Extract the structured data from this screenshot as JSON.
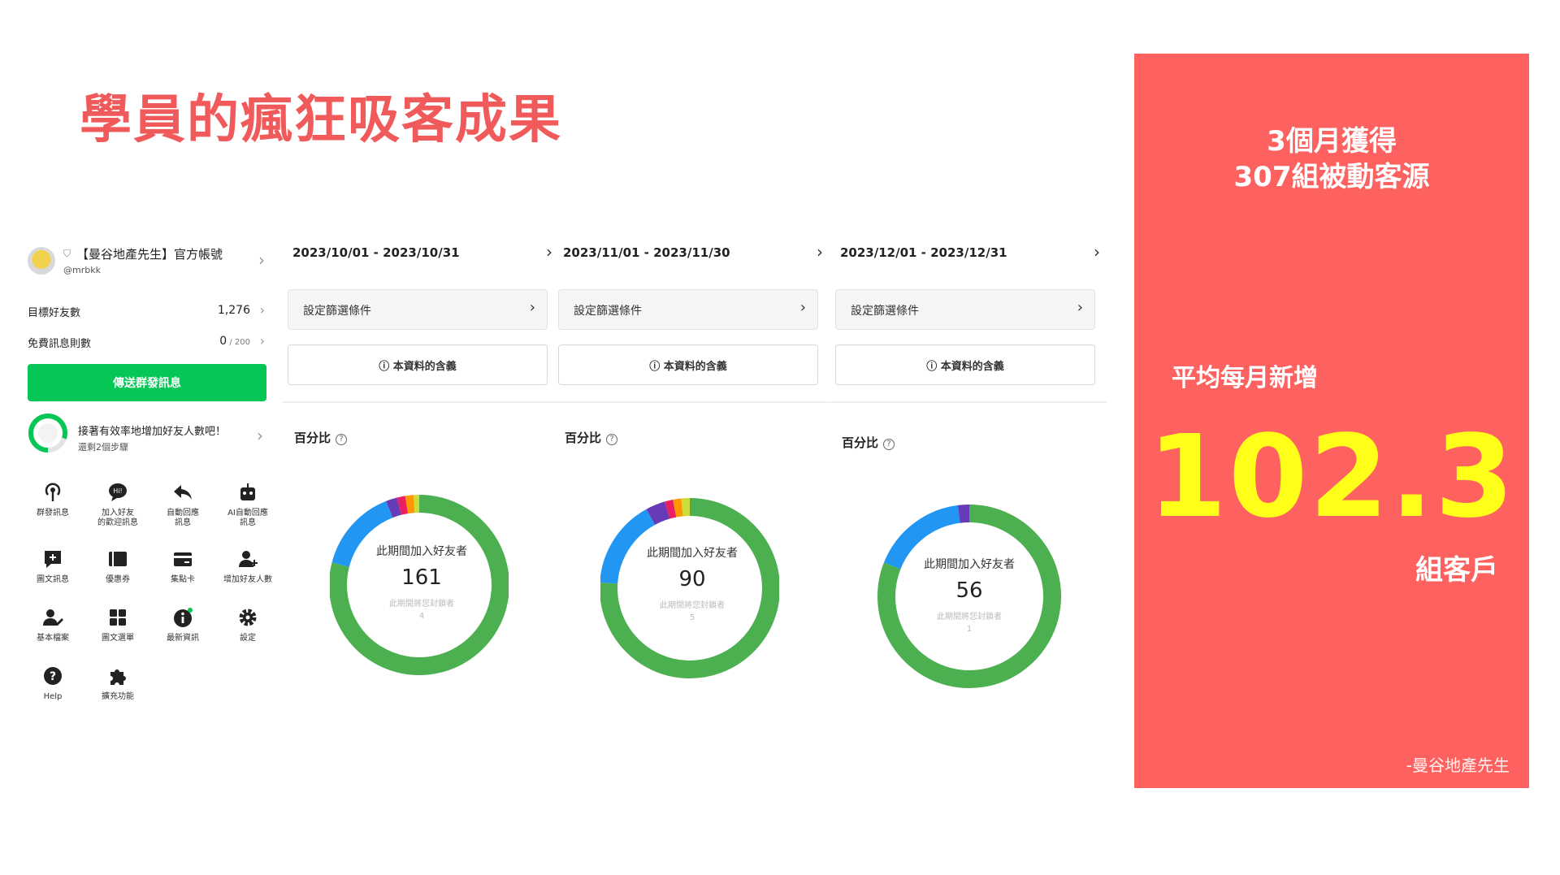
{
  "slide": {
    "title": "學員的瘋狂吸客成果"
  },
  "oa": {
    "name": "【曼谷地產先生】官方帳號",
    "id": "@mrbkk",
    "rows": [
      {
        "label": "目標好友數",
        "value": "1,276",
        "suffix": ""
      },
      {
        "label": "免費訊息則數",
        "value": "0",
        "suffix": " / 200"
      }
    ],
    "broadcast_label": "傳送群發訊息",
    "progress": {
      "title": "接著有效率地增加好友人數吧！",
      "sub": "還剩2個步驟",
      "fraction": 0.8
    },
    "menu": [
      {
        "label": "群發訊息",
        "icon": "broadcast-icon"
      },
      {
        "label": "加入好友\n的歡迎訊息",
        "icon": "greeting-bubble-icon"
      },
      {
        "label": "自動回應\n訊息",
        "icon": "reply-arrow-icon"
      },
      {
        "label": "AI自動回應\n訊息",
        "icon": "robot-icon"
      },
      {
        "label": "圖文訊息",
        "icon": "rich-message-icon"
      },
      {
        "label": "優惠券",
        "icon": "coupon-icon"
      },
      {
        "label": "集點卡",
        "icon": "point-card-icon"
      },
      {
        "label": "增加好友人數",
        "icon": "add-friend-icon"
      },
      {
        "label": "基本檔案",
        "icon": "profile-icon"
      },
      {
        "label": "圖文選單",
        "icon": "rich-menu-icon"
      },
      {
        "label": "最新資訊",
        "icon": "info-icon"
      },
      {
        "label": "設定",
        "icon": "gear-icon"
      },
      {
        "label": "Help",
        "icon": "help-icon"
      },
      {
        "label": "擴充功能",
        "icon": "puzzle-icon"
      }
    ]
  },
  "panels": [
    {
      "date_range": "2023/10/01 - 2023/10/31",
      "filter_label": "設定篩選條件",
      "meaning_label": "ⓘ 本資料的含義",
      "percent_label": "百分比",
      "center_title": "此期間加入好友者",
      "center_value": "161",
      "blocked_label": "此期間將您封鎖者",
      "blocked_value": "4"
    },
    {
      "date_range": "2023/11/01 - 2023/11/30",
      "filter_label": "設定篩選條件",
      "meaning_label": "ⓘ 本資料的含義",
      "percent_label": "百分比",
      "center_title": "此期間加入好友者",
      "center_value": "90",
      "blocked_label": "此期間將您封鎖者",
      "blocked_value": "5"
    },
    {
      "date_range": "2023/12/01 - 2023/12/31",
      "filter_label": "設定篩選條件",
      "meaning_label": "ⓘ 本資料的含義",
      "percent_label": "百分比",
      "center_title": "此期間加入好友者",
      "center_value": "56",
      "blocked_label": "此期間將您封鎖者",
      "blocked_value": "1"
    }
  ],
  "chart_data": [
    {
      "type": "pie",
      "categories": [
        "",
        "",
        "",
        "",
        "",
        ""
      ],
      "values": [
        79,
        15,
        2,
        1.5,
        1.5,
        1
      ],
      "colors": [
        "#4caf50",
        "#2196f3",
        "#673ab7",
        "#e91e63",
        "#ff9800",
        "#cddc39"
      ]
    },
    {
      "type": "pie",
      "categories": [
        "",
        "",
        "",
        "",
        "",
        ""
      ],
      "values": [
        76,
        16,
        3.5,
        1.5,
        1.5,
        1.5
      ],
      "colors": [
        "#4caf50",
        "#2196f3",
        "#673ab7",
        "#e91e63",
        "#ff9800",
        "#cddc39"
      ]
    },
    {
      "type": "pie",
      "categories": [
        "",
        "",
        ""
      ],
      "values": [
        81,
        17,
        2
      ],
      "colors": [
        "#4caf50",
        "#2196f3",
        "#673ab7"
      ]
    }
  ],
  "card": {
    "headline_line1": "3個月獲得",
    "headline_line2": "307組被動客源",
    "avg_label": "平均每月新增",
    "avg_value": "102.3",
    "unit": "組客戶",
    "signature": "-曼谷地產先生",
    "bg_color": "#fd6260",
    "value_color": "#ffff1a"
  },
  "colors": {
    "title": "#f05a5a",
    "line_green": "#06c755"
  }
}
